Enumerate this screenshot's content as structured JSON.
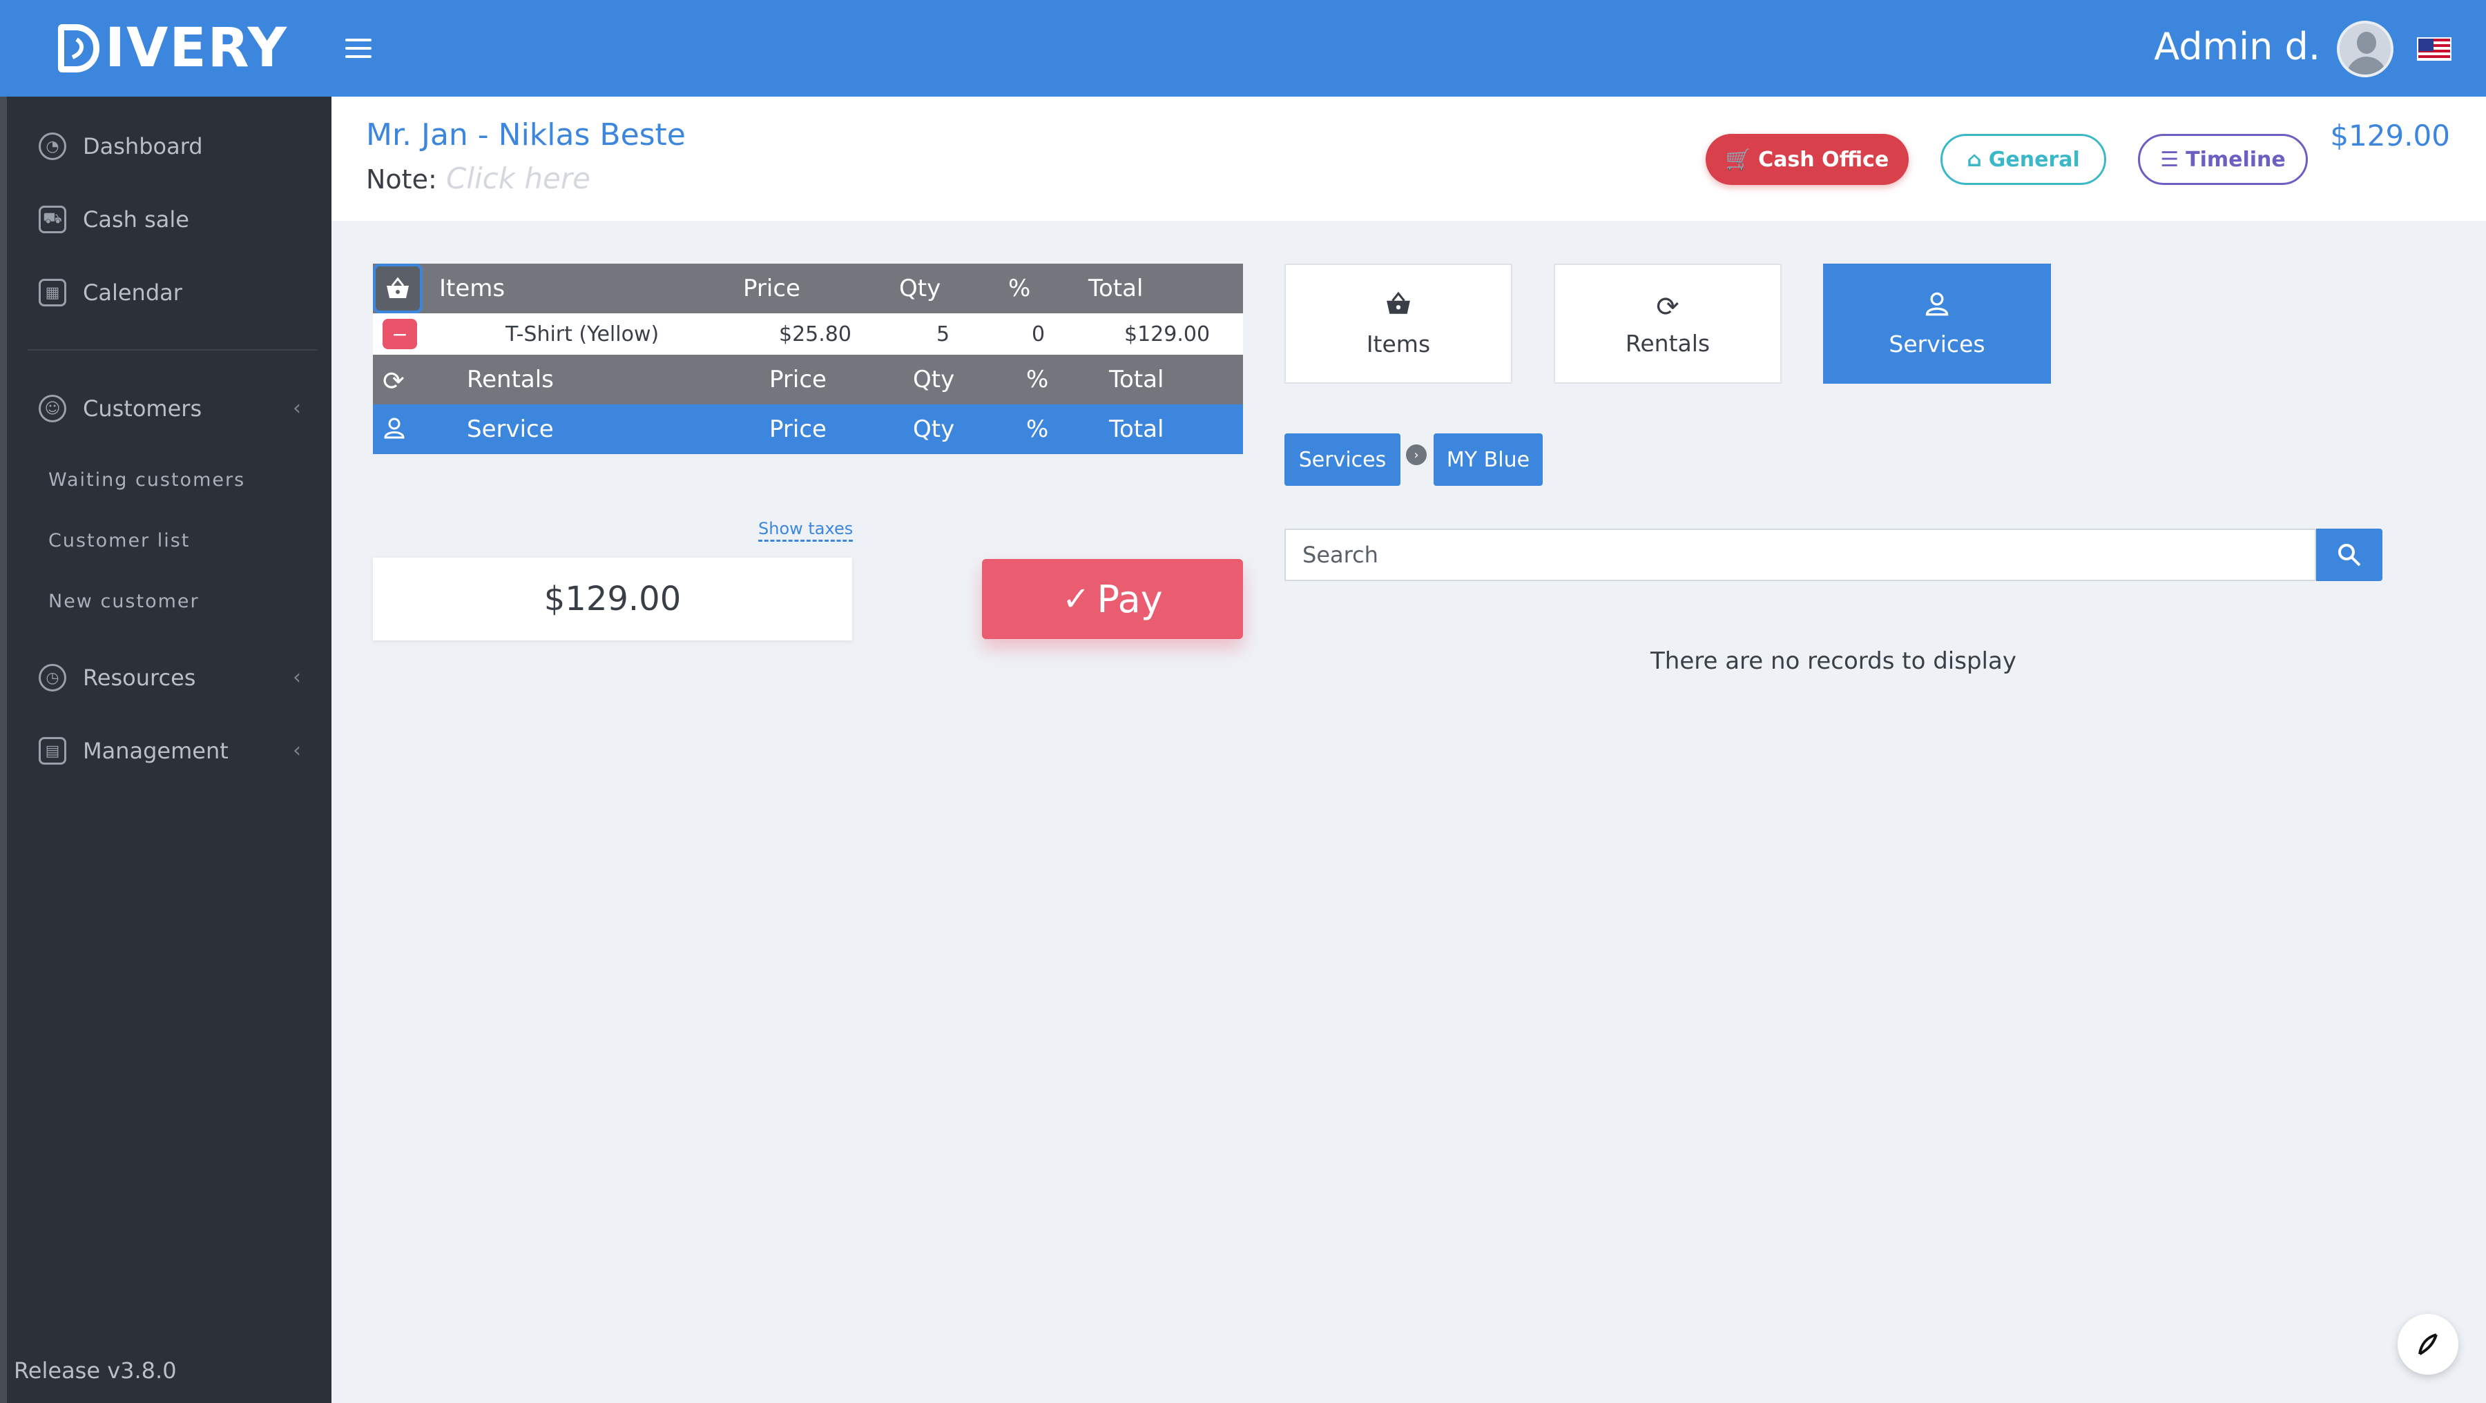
{
  "header": {
    "logo_text": "IVERY",
    "admin_name": "Admin d.",
    "colors": {
      "topbar": "#3c87dd",
      "sidebar": "#2c3038"
    }
  },
  "sidebar": {
    "items": [
      {
        "label": "Dashboard",
        "icon": "speedometer-icon"
      },
      {
        "label": "Cash sale",
        "icon": "cart-icon"
      },
      {
        "label": "Calendar",
        "icon": "calendar-icon"
      },
      {
        "label": "Customers",
        "icon": "users-icon"
      },
      {
        "label": "Resources",
        "icon": "gauge-icon"
      },
      {
        "label": "Management",
        "icon": "report-icon"
      }
    ],
    "sub_items": [
      "Waiting customers",
      "Customer list",
      "New customer"
    ],
    "release": "Release v3.8.0"
  },
  "customer": {
    "name": "Mr. Jan - Niklas  Beste",
    "note_label": "Note:",
    "note_placeholder": "Click here"
  },
  "actions": {
    "cash_office": "Cash Office",
    "general": "General",
    "timeline": "Timeline",
    "total": "$129.00"
  },
  "cart": {
    "items_header": {
      "label": "Items",
      "price": "Price",
      "qty": "Qty",
      "pct": "%",
      "total": "Total"
    },
    "lines": [
      {
        "name": "T-Shirt (Yellow)",
        "price": "$25.80",
        "qty": "5",
        "pct": "0",
        "total": "$129.00"
      }
    ],
    "rentals_header": {
      "label": "Rentals",
      "price": "Price",
      "qty": "Qty",
      "pct": "%",
      "total": "Total"
    },
    "service_header": {
      "label": "Service",
      "price": "Price",
      "qty": "Qty",
      "pct": "%",
      "total": "Total"
    },
    "show_taxes": "Show taxes",
    "grand_total": "$129.00",
    "pay_label": "Pay"
  },
  "categories": {
    "items": "Items",
    "rentals": "Rentals",
    "services": "Services",
    "active": "Services"
  },
  "breadcrumb": [
    "Services",
    "MY Blue"
  ],
  "search": {
    "placeholder": "Search"
  },
  "empty_message": "There are no records to display"
}
